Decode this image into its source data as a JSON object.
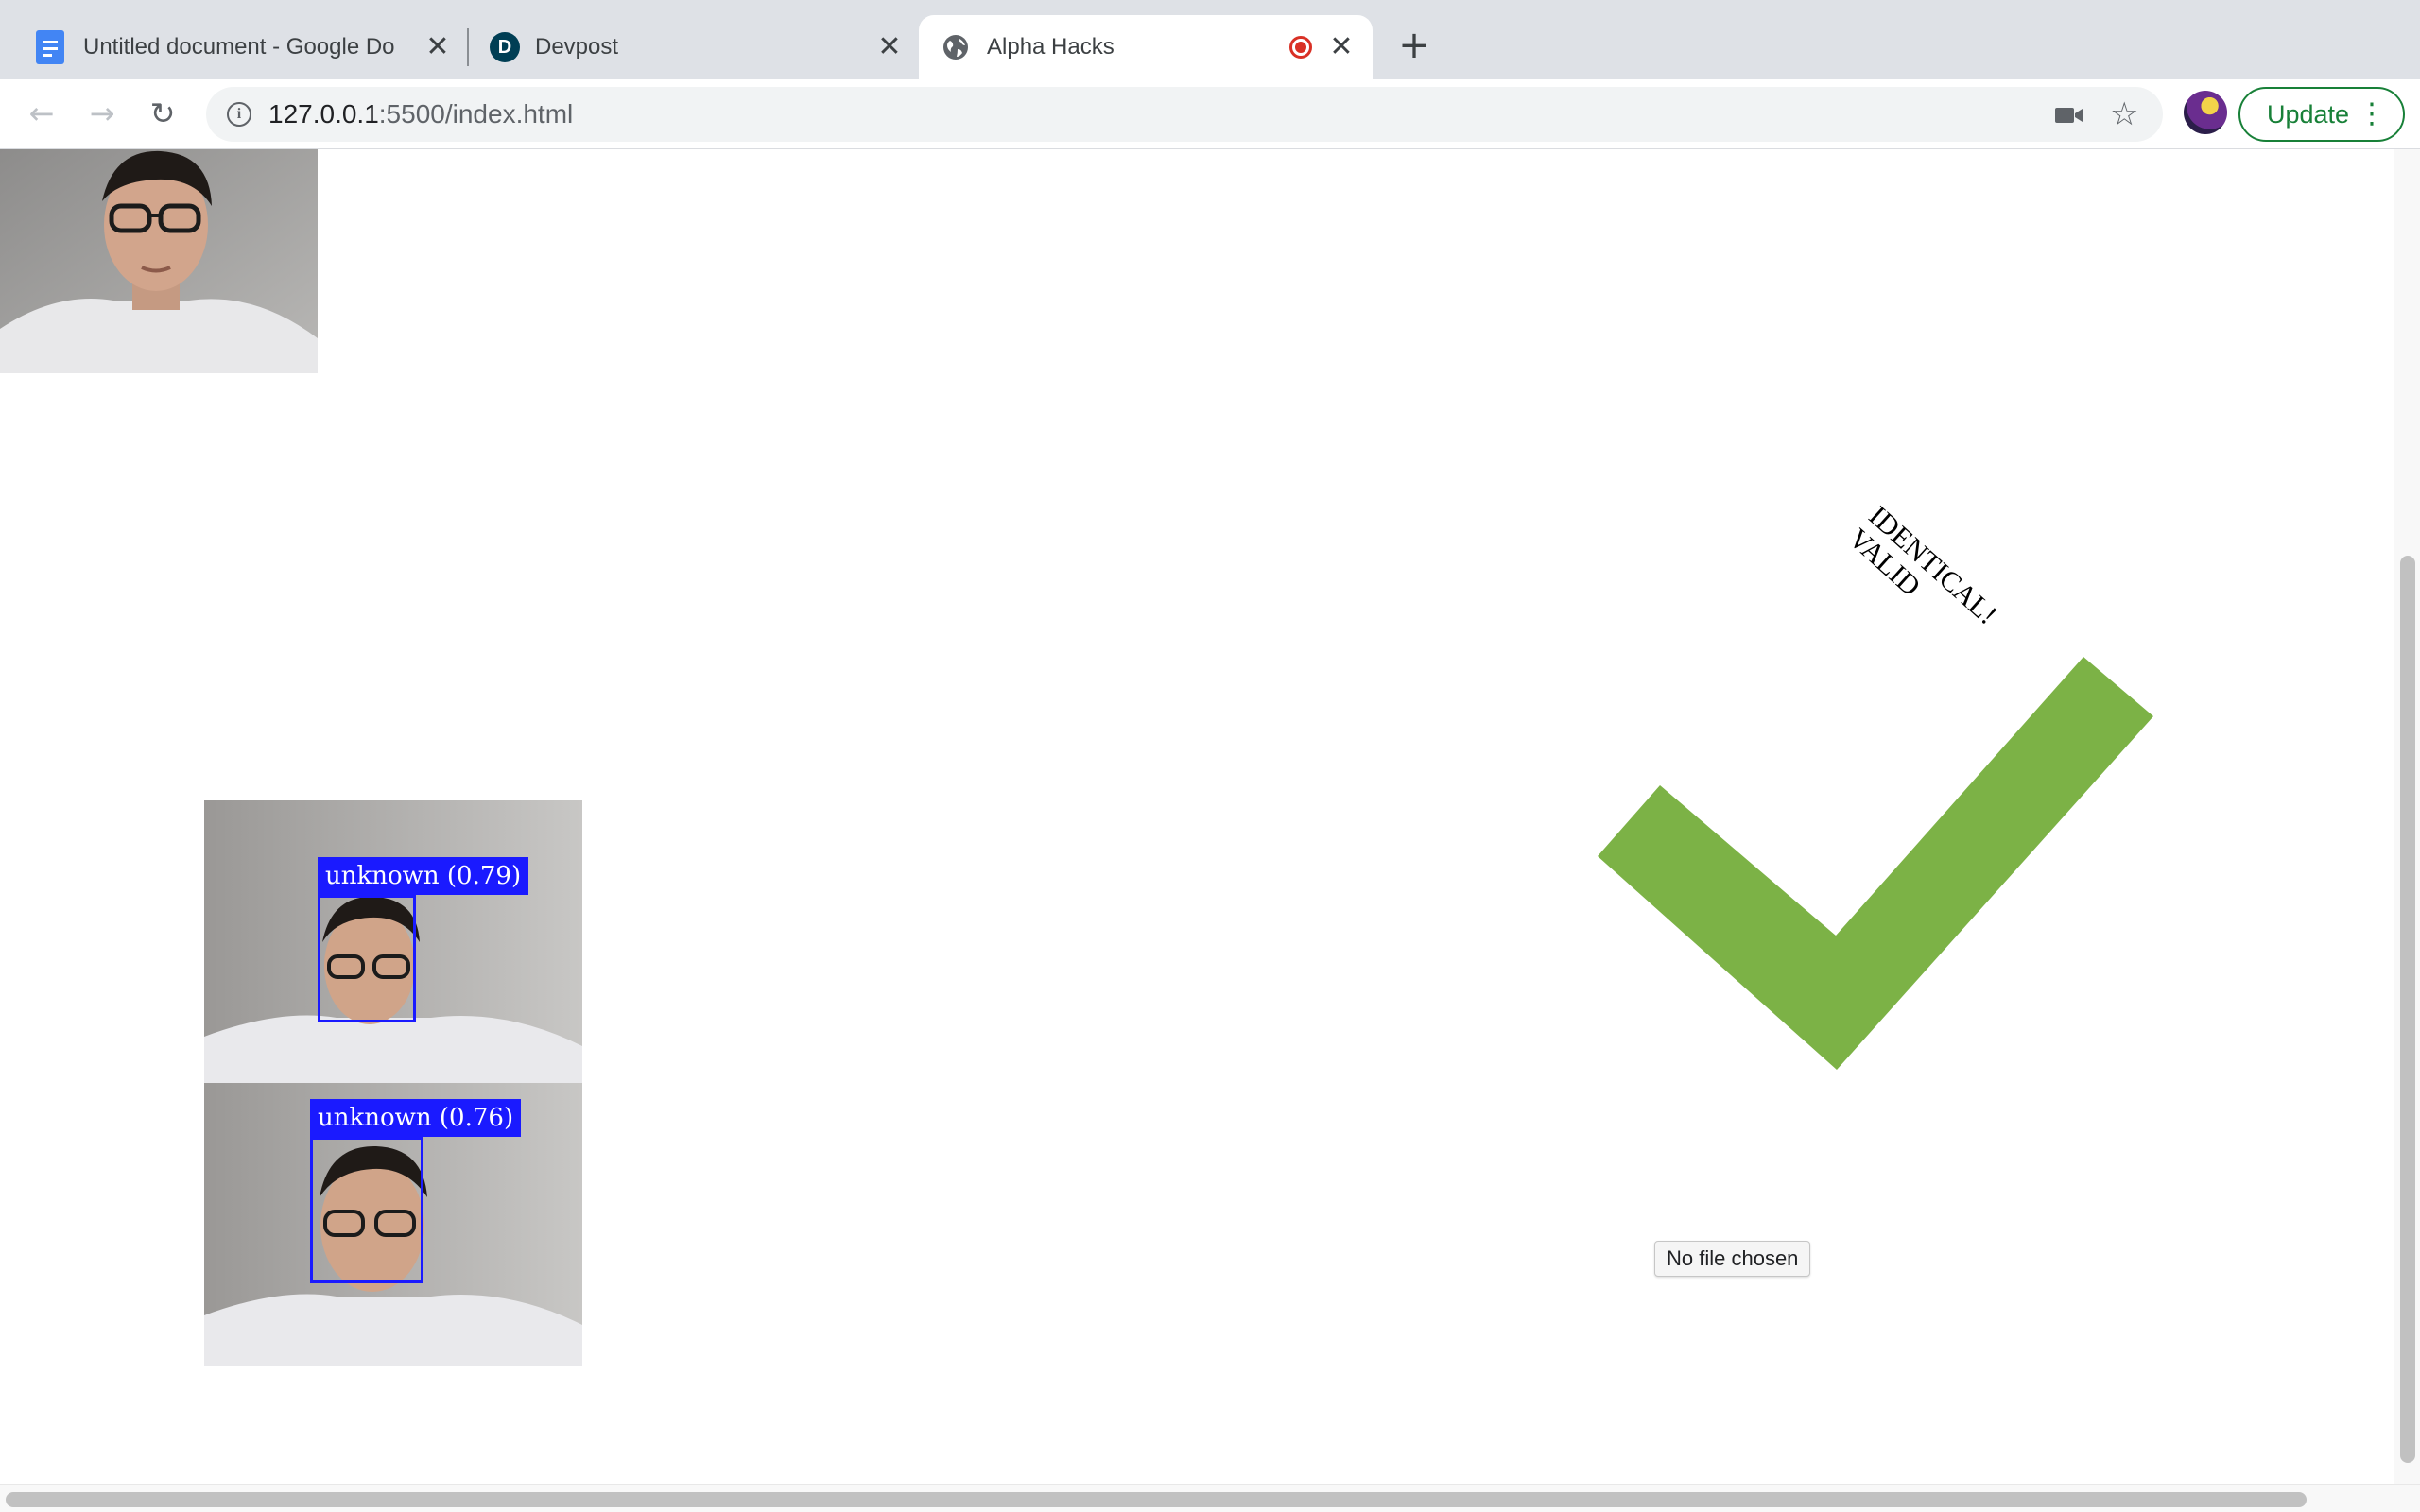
{
  "browser": {
    "tabs": [
      {
        "title": "Untitled document - Google Do",
        "favicon": "google-docs-icon",
        "active": false
      },
      {
        "title": "Devpost",
        "favicon": "devpost-icon",
        "favicon_letter": "D",
        "active": false
      },
      {
        "title": "Alpha Hacks",
        "favicon": "globe-icon",
        "active": true,
        "recording": true
      }
    ],
    "new_tab_symbol": "+",
    "close_symbol": "✕",
    "url_host": "127.0.0.1",
    "url_path": ":5500/index.html",
    "info_symbol": "i",
    "update_label": "Update",
    "kebab_symbol": "⋮",
    "star_symbol": "☆",
    "back_symbol": "←",
    "forward_symbol": "→",
    "reload_symbol": "↻"
  },
  "page": {
    "status_line1": "IDENTICAL!",
    "status_line2": "VALID",
    "check_color": "#7cb246",
    "file_input_text": "No file chosen",
    "faces": [
      {
        "label": "unknown (0.79)"
      },
      {
        "label": "unknown (0.76)"
      }
    ],
    "box_color": "#1a1aff"
  }
}
